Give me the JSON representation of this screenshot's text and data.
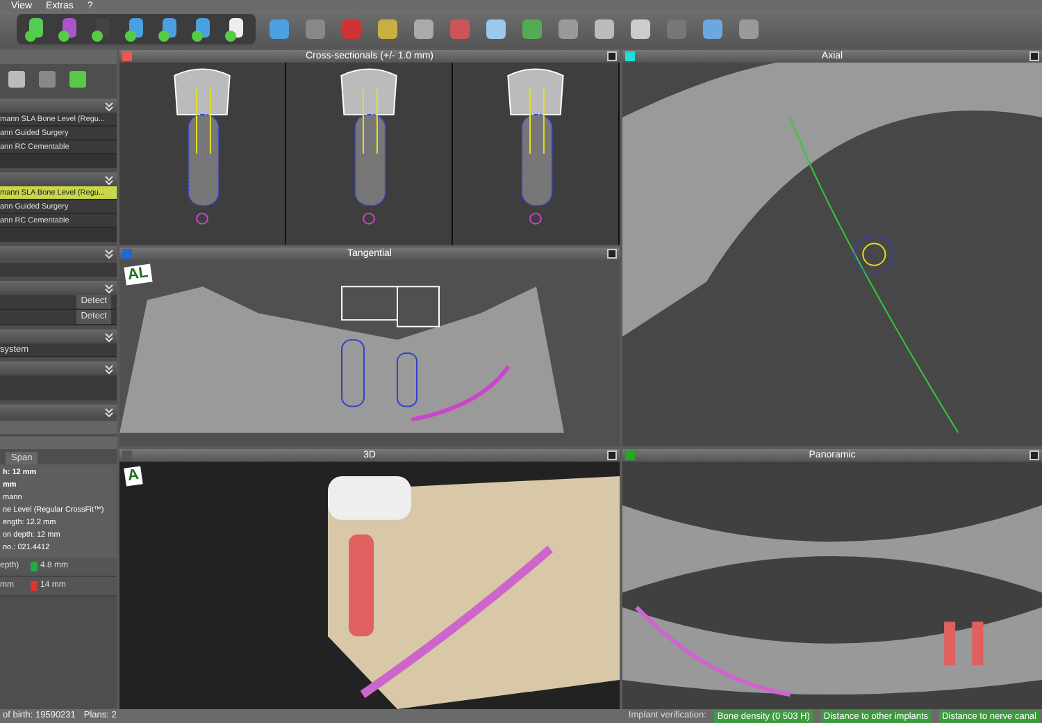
{
  "menu": [
    "View",
    "Extras",
    "?"
  ],
  "left_panel": {
    "groups": [
      {
        "items": [
          {
            "label": "mann SLA Bone Level (Regu...",
            "selected": false
          },
          {
            "label": "ann Guided Surgery",
            "selected": false
          },
          {
            "label": "ann RC Cementable",
            "selected": false
          }
        ]
      },
      {
        "items": [
          {
            "label": "mann SLA Bone Level (Regu...",
            "selected": true
          },
          {
            "label": "ann Guided Surgery",
            "selected": false
          },
          {
            "label": "ann RC Cementable",
            "selected": false
          }
        ]
      }
    ],
    "detect_buttons": [
      "Detect",
      "Detect"
    ],
    "system_field": "system",
    "tab": "Span",
    "info_lines": [
      {
        "text": "h: 12 mm",
        "bold": true
      },
      {
        "text": "mm",
        "bold": true
      },
      {
        "text": "mann",
        "bold": false
      },
      {
        "text": "ne Level (Regular CrossFit™)",
        "bold": false
      },
      {
        "text": "ength: 12.2 mm",
        "bold": false
      },
      {
        "text": "on depth: 12 mm",
        "bold": false
      },
      {
        "text": "no.: 021.4412",
        "bold": false
      }
    ],
    "measures": [
      {
        "label": "epth)",
        "value": "4.8 mm",
        "color": "#22aa44"
      },
      {
        "label": "mm",
        "value": "14 mm",
        "color": "#dd3333"
      }
    ]
  },
  "viewports": [
    {
      "title": "Cross-sectionals (+/- 1.0 mm)",
      "kind": "cross",
      "color": "#ee5555"
    },
    {
      "title": "Axial",
      "kind": "axial",
      "color": "#22dddd"
    },
    {
      "title": "Tangential",
      "kind": "tangential",
      "color": "#2266dd",
      "orientation": "AL"
    },
    {
      "title": "3D",
      "kind": "model",
      "color": "#555555",
      "orientation": "A"
    },
    {
      "title": "Panoramic",
      "kind": "panoramic",
      "color": "#22aa22"
    }
  ],
  "status_bar": {
    "patient": "of birth: 19590231",
    "plans": "Plans: 2",
    "verification_label": "Implant verification:",
    "checks": [
      "Bone density (0 503 H)",
      "Distance to other implants",
      "Distance to nerve canal"
    ]
  }
}
